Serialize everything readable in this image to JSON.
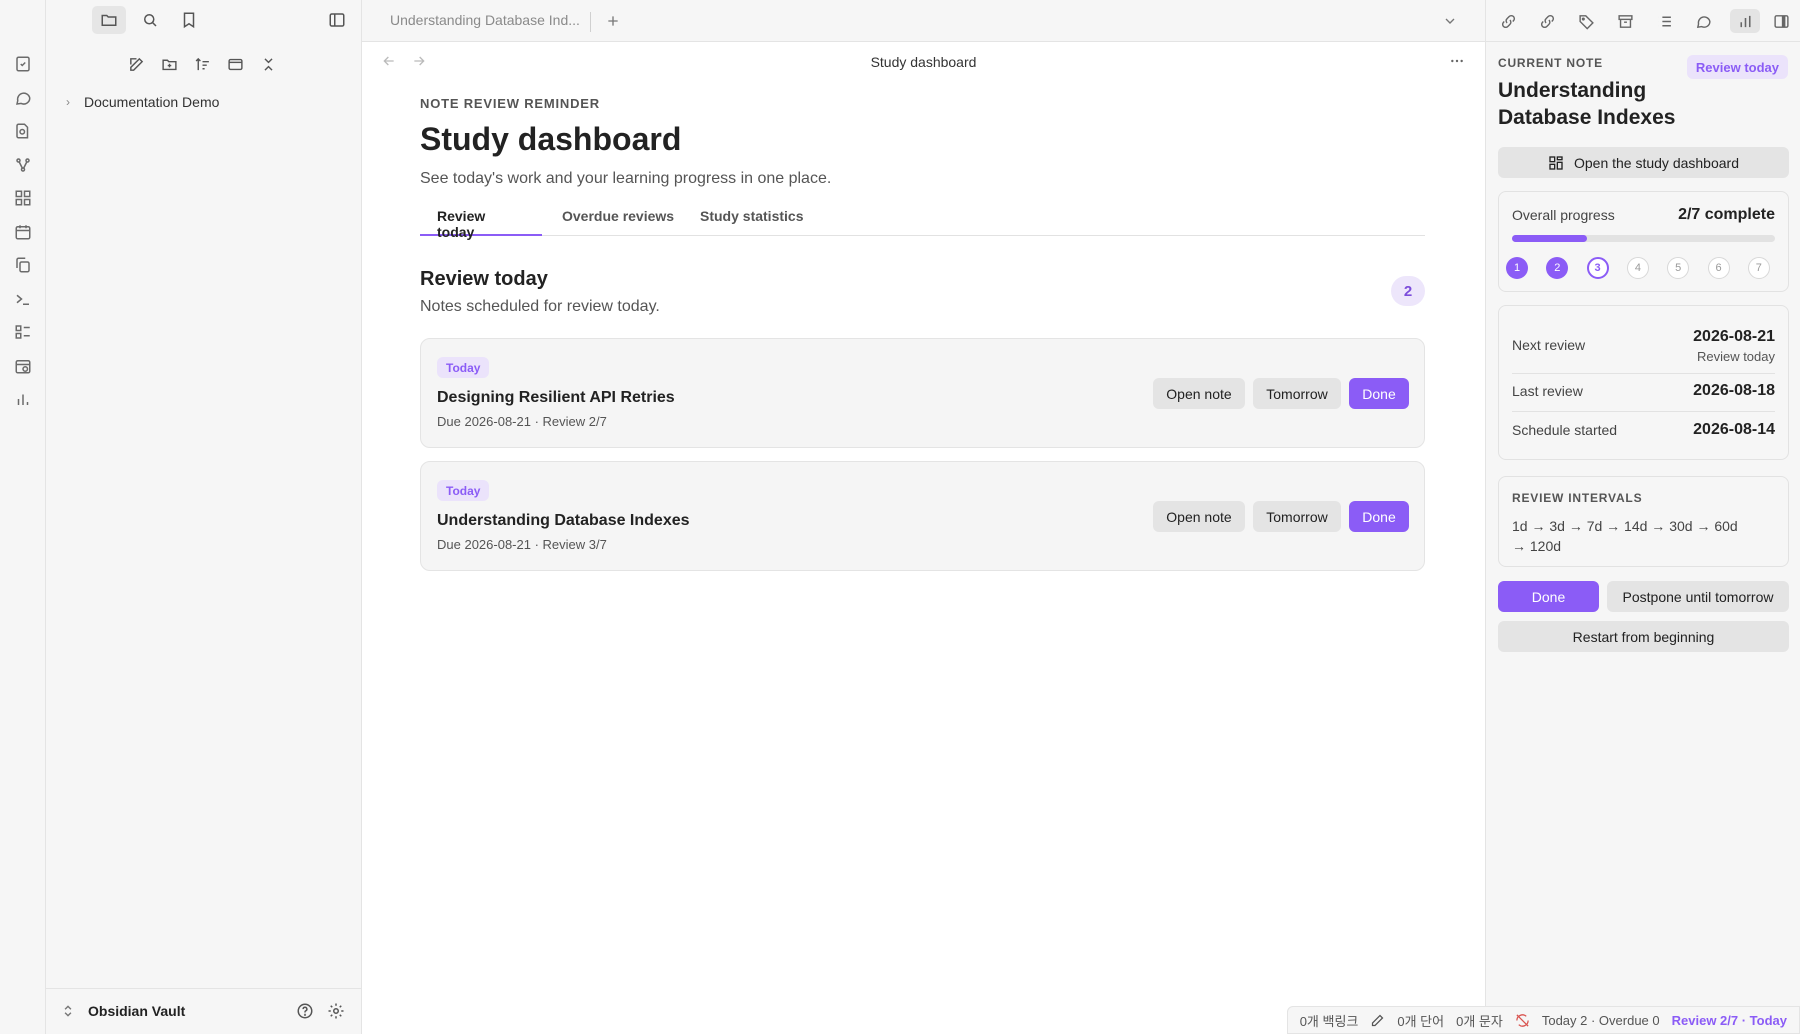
{
  "window": {
    "tab_title": "Understanding Database Ind...",
    "view_title": "Study dashboard"
  },
  "left_sidebar": {
    "tree": [
      {
        "label": "Documentation Demo",
        "expanded": false
      }
    ],
    "vault_name": "Obsidian Vault"
  },
  "page": {
    "eyebrow": "NOTE REVIEW REMINDER",
    "title": "Study dashboard",
    "subtitle": "See today's work and your learning progress in one place.",
    "tabs": [
      {
        "label": "Review today",
        "active": true
      },
      {
        "label": "Overdue reviews",
        "active": false
      },
      {
        "label": "Study statistics",
        "active": false
      }
    ],
    "section": {
      "title": "Review today",
      "subtitle": "Notes scheduled for review today.",
      "count": "2"
    },
    "cards": [
      {
        "badge": "Today",
        "title": "Designing Resilient API Retries",
        "meta": "Due 2026-08-21 · Review 2/7",
        "open_label": "Open note",
        "tomorrow_label": "Tomorrow",
        "done_label": "Done"
      },
      {
        "badge": "Today",
        "title": "Understanding Database Indexes",
        "meta": "Due 2026-08-21 · Review 3/7",
        "open_label": "Open note",
        "tomorrow_label": "Tomorrow",
        "done_label": "Done"
      }
    ]
  },
  "right_panel": {
    "eyebrow": "CURRENT NOTE",
    "badge": "Review today",
    "note_title_line1": "Understanding",
    "note_title_line2": "Database Indexes",
    "open_dashboard_label": "Open the study dashboard",
    "progress": {
      "label": "Overall progress",
      "value_text": "2/7 complete",
      "fraction": 0.2857,
      "steps": [
        {
          "n": "1",
          "state": "done"
        },
        {
          "n": "2",
          "state": "done"
        },
        {
          "n": "3",
          "state": "current"
        },
        {
          "n": "4",
          "state": "pending"
        },
        {
          "n": "5",
          "state": "pending"
        },
        {
          "n": "6",
          "state": "pending"
        },
        {
          "n": "7",
          "state": "pending"
        }
      ]
    },
    "next_review": {
      "label": "Next review",
      "value": "2026-08-21",
      "note": "Review today"
    },
    "last_review": {
      "label": "Last review",
      "value": "2026-08-18"
    },
    "schedule_started": {
      "label": "Schedule started",
      "value": "2026-08-14"
    },
    "intervals": {
      "title": "REVIEW INTERVALS",
      "text": "1d → 3d → 7d → 14d → 30d → 60d → 120d"
    },
    "done_label": "Done",
    "postpone_label": "Postpone until tomorrow",
    "restart_label": "Restart from beginning"
  },
  "status_bar": {
    "backlinks": "0개 백링크",
    "words": "0개 단어",
    "chars": "0개 문자",
    "review_counts": "Today 2 · Overdue 0",
    "review_status": "Review 2/7 · Today"
  },
  "colors": {
    "accent": "#8b5cf6",
    "accent_soft": "#ebe3fb"
  }
}
